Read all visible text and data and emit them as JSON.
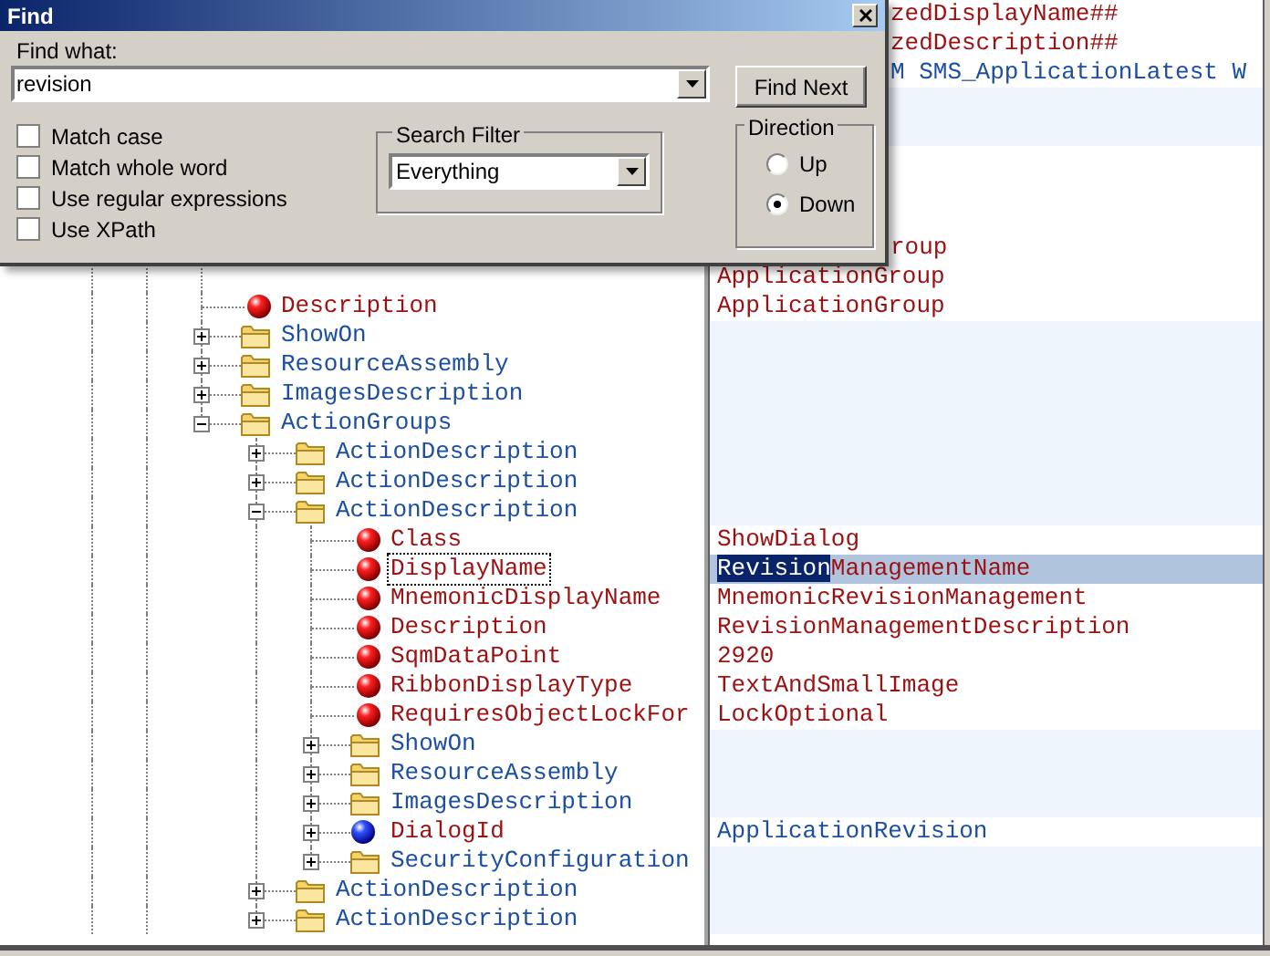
{
  "dialog": {
    "title": "Find",
    "find_what_label": "Find what:",
    "find_what": {
      "value": "revision"
    },
    "find_next": "Find Next",
    "options": [
      {
        "label": "Match case",
        "checked": false
      },
      {
        "label": "Match whole word",
        "checked": false
      },
      {
        "label": "Use regular expressions",
        "checked": false
      },
      {
        "label": "Use XPath",
        "checked": false
      }
    ],
    "search_filter": {
      "label": "Search Filter",
      "value": "Everything"
    },
    "direction": {
      "label": "Direction",
      "options": [
        {
          "label": "Up",
          "selected": false
        },
        {
          "label": "Down",
          "selected": true
        }
      ]
    }
  },
  "values_behind_dialog": [
    {
      "text": "zedDisplayName##",
      "kind": "property"
    },
    {
      "text": "zedDescription##",
      "kind": "property"
    },
    {
      "text": "M SMS_ApplicationLatest W",
      "kind": "reference"
    },
    {
      "kind": "folder"
    },
    {
      "kind": "folder"
    },
    {
      "kind": "property"
    },
    {
      "kind": "property"
    },
    {
      "kind": "property"
    },
    {
      "text": "roup",
      "kind": "property"
    },
    {
      "text": "ApplicationGroup",
      "kind": "property",
      "uncovered": true
    }
  ],
  "tree": [
    {
      "label": "Description",
      "kind": "property",
      "selected": false,
      "value": "ApplicationGroup"
    },
    {
      "label": "ShowOn",
      "kind": "folder",
      "expanded": false,
      "selected": false
    },
    {
      "label": "ResourceAssembly",
      "kind": "folder",
      "expanded": false,
      "selected": false
    },
    {
      "label": "ImagesDescription",
      "kind": "folder",
      "expanded": false,
      "selected": false
    },
    {
      "label": "ActionGroups",
      "kind": "folder",
      "expanded": true,
      "selected": false,
      "children": [
        {
          "label": "ActionDescription",
          "kind": "folder",
          "expanded": false,
          "selected": false
        },
        {
          "label": "ActionDescription",
          "kind": "folder",
          "expanded": false,
          "selected": false
        },
        {
          "label": "ActionDescription",
          "kind": "folder",
          "expanded": true,
          "selected": false,
          "children": [
            {
              "label": "Class",
              "kind": "property",
              "selected": false,
              "value": "ShowDialog"
            },
            {
              "label": "DisplayName",
              "kind": "property",
              "selected": true,
              "highlight": "Revision",
              "value": "ManagementName"
            },
            {
              "label": "MnemonicDisplayName",
              "kind": "property",
              "selected": false,
              "value": "MnemonicRevisionManagement"
            },
            {
              "label": "Description",
              "kind": "property",
              "selected": false,
              "value": "RevisionManagementDescription"
            },
            {
              "label": "SqmDataPoint",
              "kind": "property",
              "selected": false,
              "value": "2920"
            },
            {
              "label": "RibbonDisplayType",
              "kind": "property",
              "selected": false,
              "value": "TextAndSmallImage"
            },
            {
              "label": "RequiresObjectLockFor",
              "kind": "property",
              "selected": false,
              "value": "LockOptional"
            },
            {
              "label": "ShowOn",
              "kind": "folder",
              "expanded": false,
              "selected": false
            },
            {
              "label": "ResourceAssembly",
              "kind": "folder",
              "expanded": false,
              "selected": false
            },
            {
              "label": "ImagesDescription",
              "kind": "folder",
              "expanded": false,
              "selected": false
            },
            {
              "label": "DialogId",
              "kind": "reference",
              "expanded": false,
              "selected": false,
              "value": "ApplicationRevision"
            },
            {
              "label": "SecurityConfiguration",
              "kind": "folder",
              "expanded": false,
              "selected": false
            }
          ]
        },
        {
          "label": "ActionDescription",
          "kind": "folder",
          "expanded": false,
          "selected": false
        },
        {
          "label": "ActionDescription",
          "kind": "folder",
          "expanded": false,
          "selected": false
        }
      ]
    }
  ]
}
